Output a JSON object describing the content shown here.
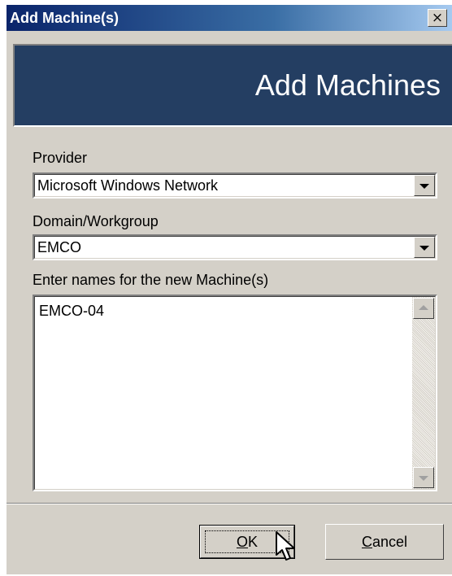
{
  "window": {
    "title": "Add Machine(s)",
    "close_glyph": "×"
  },
  "banner": {
    "text": "Add Machines"
  },
  "provider": {
    "label": "Provider",
    "value": "Microsoft Windows Network"
  },
  "domain": {
    "label": "Domain/Workgroup",
    "value": "EMCO"
  },
  "machines": {
    "label": "Enter names for the new Machine(s)",
    "value": "EMCO-04"
  },
  "buttons": {
    "ok_mnemonic": "O",
    "ok_rest": "K",
    "cancel_mnemonic": "C",
    "cancel_rest": "ancel"
  },
  "icons": {
    "combo_arrow": "chevron-down-icon",
    "scroll_up": "scroll-up-arrow-icon",
    "scroll_down": "scroll-down-arrow-icon",
    "cursor": "mouse-pointer-icon",
    "close": "close-icon"
  },
  "colors": {
    "title_bar_start": "#0a246a",
    "banner_bg": "#243e62",
    "window_bg": "#d4d0c8"
  }
}
